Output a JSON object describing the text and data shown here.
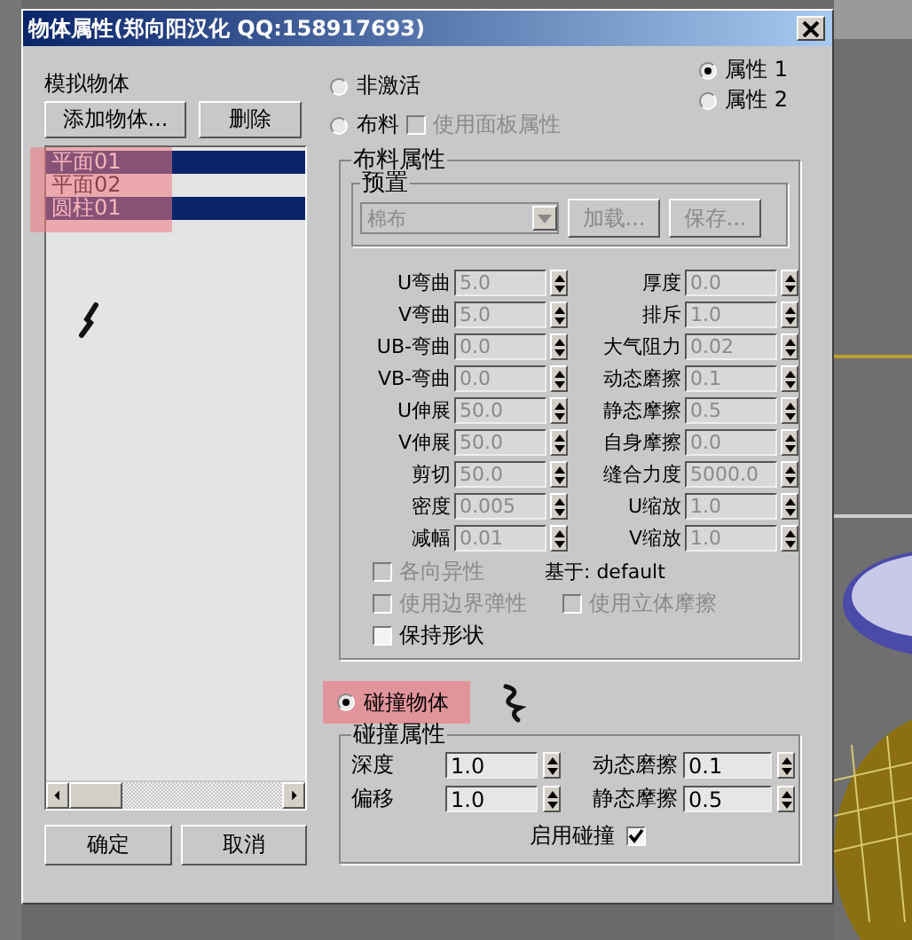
{
  "window": {
    "title": "物体属性(郑向阳汉化 QQ:158917693)"
  },
  "objects": {
    "label": "模拟物体",
    "buttons": [
      "添加物体...",
      "删除"
    ],
    "items": [
      {
        "name": "平面01",
        "selected": true
      },
      {
        "name": "平面02",
        "selected": false
      },
      {
        "name": "圆柱01",
        "selected": true
      }
    ]
  },
  "modes": [
    {
      "label": "非激活",
      "selected": false
    },
    {
      "label": "布料",
      "selected": false
    },
    {
      "label": "碰撞物体",
      "selected": true
    }
  ],
  "property_sets": [
    {
      "label": "属性 1",
      "selected": true
    },
    {
      "label": "属性 2",
      "selected": false
    }
  ],
  "use_panel_properties": {
    "label": "使用面板属性",
    "checked": false,
    "disabled": true
  },
  "cloth": {
    "title": "布料属性",
    "disabled": true,
    "preset": {
      "title": "预置",
      "value": "棉布",
      "buttons": [
        "加载...",
        "保存..."
      ]
    },
    "params_left": [
      {
        "label": "U弯曲",
        "value": "5.0"
      },
      {
        "label": "V弯曲",
        "value": "5.0"
      },
      {
        "label": "UB-弯曲",
        "value": "0.0"
      },
      {
        "label": "VB-弯曲",
        "value": "0.0"
      },
      {
        "label": "U伸展",
        "value": "50.0"
      },
      {
        "label": "V伸展",
        "value": "50.0"
      },
      {
        "label": "剪切",
        "value": "50.0"
      },
      {
        "label": "密度",
        "value": "0.005"
      },
      {
        "label": "减幅",
        "value": "0.01"
      }
    ],
    "params_right": [
      {
        "label": "厚度",
        "value": "0.0"
      },
      {
        "label": "排斥",
        "value": "1.0"
      },
      {
        "label": "大气阻力",
        "value": "0.02"
      },
      {
        "label": "动态磨擦",
        "value": "0.1"
      },
      {
        "label": "静态摩擦",
        "value": "0.5"
      },
      {
        "label": "自身摩擦",
        "value": "0.0"
      },
      {
        "label": "缝合力度",
        "value": "5000.0"
      },
      {
        "label": "U缩放",
        "value": "1.0"
      },
      {
        "label": "V缩放",
        "value": "1.0"
      }
    ],
    "based_on": "基于: default",
    "options": [
      {
        "label": "各向异性",
        "checked": false,
        "disabled": true
      },
      {
        "label": "使用边界弹性",
        "checked": false,
        "disabled": true
      },
      {
        "label": "使用立体摩擦",
        "checked": false,
        "disabled": true
      },
      {
        "label": "保持形状",
        "checked": false,
        "disabled": false
      }
    ]
  },
  "collision": {
    "title": "碰撞属性",
    "params": [
      {
        "label": "深度",
        "value": "1.0"
      },
      {
        "label": "偏移",
        "value": "1.0"
      },
      {
        "label": "动态磨擦",
        "value": "0.1"
      },
      {
        "label": "静态摩擦",
        "value": "0.5"
      }
    ],
    "enable": {
      "label": "启用碰撞",
      "checked": true
    }
  },
  "footer_buttons": [
    "确定",
    "取消"
  ]
}
